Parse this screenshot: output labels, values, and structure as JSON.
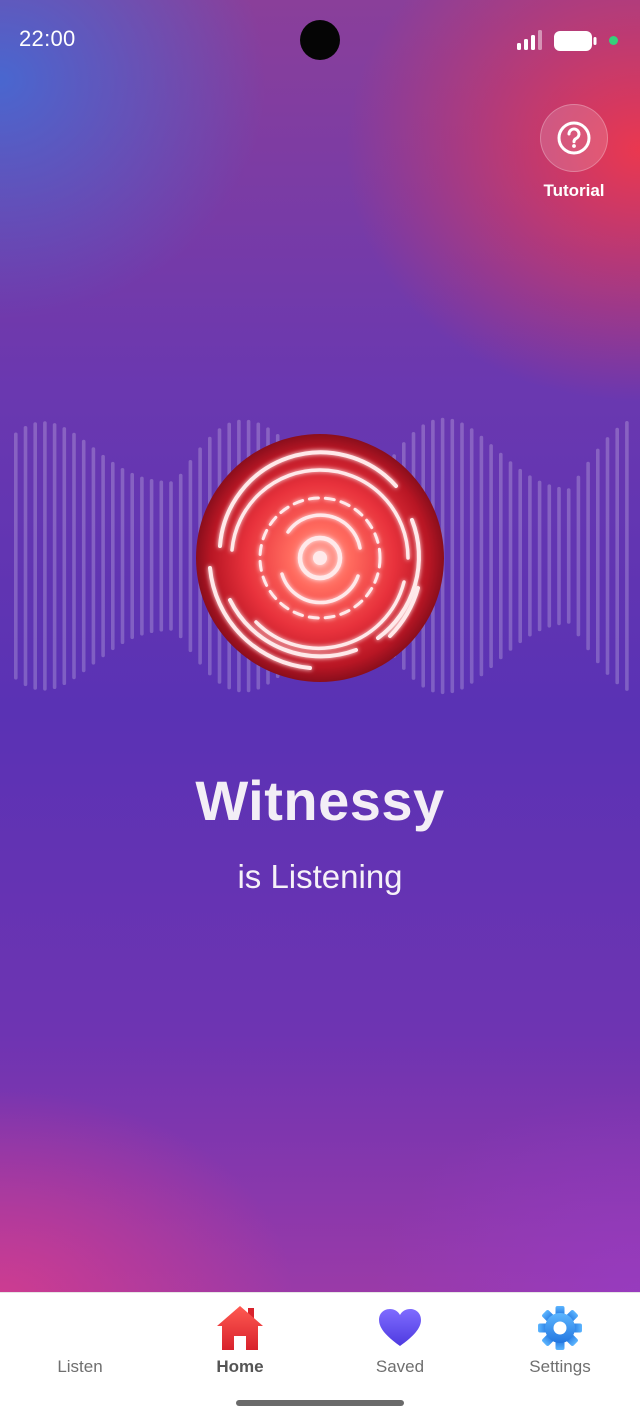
{
  "status_bar": {
    "time": "22:00",
    "icons": [
      "signal-icon",
      "battery-icon",
      "privacy-indicator-dot"
    ]
  },
  "tutorial": {
    "icon": "question-circle-icon",
    "label": "Tutorial"
  },
  "main": {
    "title": "Witnessy",
    "status_text": "is Listening",
    "record_button_icon": "listening-orb-icon"
  },
  "bottom_nav": {
    "items": [
      {
        "label": "Listen",
        "icon": "waveform-icon",
        "active": false
      },
      {
        "label": "Home",
        "icon": "home-icon",
        "active": true
      },
      {
        "label": "Saved",
        "icon": "heart-icon",
        "active": false
      },
      {
        "label": "Settings",
        "icon": "gear-icon",
        "active": false
      }
    ]
  },
  "colors": {
    "accent_red": "#e8323c",
    "gradient_blue": "#4669d2",
    "gradient_purple": "#5a32b4",
    "gradient_pink": "#d73c8c",
    "nav_blue": "#2b8fe6",
    "heart_purple": "#6a55f0"
  }
}
